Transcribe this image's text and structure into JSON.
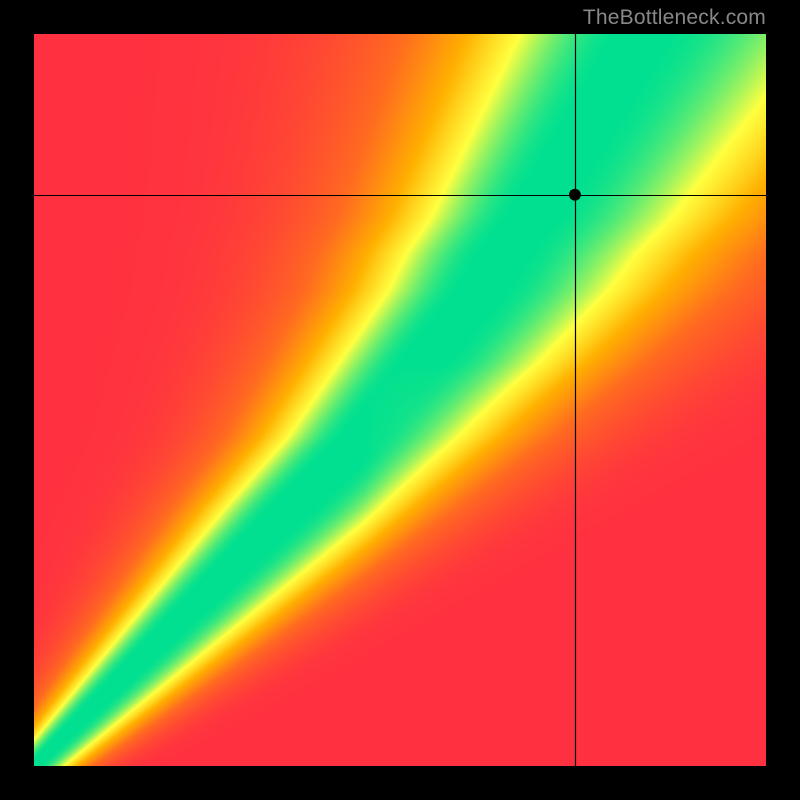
{
  "watermark": "TheBottleneck.com",
  "chart_data": {
    "type": "heatmap",
    "title": "",
    "xlabel": "",
    "ylabel": "",
    "xlim": [
      0,
      1
    ],
    "ylim": [
      0,
      1
    ],
    "marker": {
      "x": 0.74,
      "y": 0.78
    },
    "crosshair": {
      "x": 0.74,
      "y": 0.78
    },
    "color_scale": [
      "#ff3040",
      "#ff6a20",
      "#ffb000",
      "#ffff40",
      "#00e090"
    ],
    "description": "Smooth 2D heatmap with a narrow green optimal band curving from lower-left to upper-right; red in far corners, orange/yellow gradient elsewhere.",
    "optimal_band": [
      {
        "y": 0.0,
        "x": 0.0,
        "width": 0.02
      },
      {
        "y": 0.05,
        "x": 0.05,
        "width": 0.03
      },
      {
        "y": 0.1,
        "x": 0.1,
        "width": 0.04
      },
      {
        "y": 0.15,
        "x": 0.15,
        "width": 0.05
      },
      {
        "y": 0.2,
        "x": 0.2,
        "width": 0.06
      },
      {
        "y": 0.25,
        "x": 0.25,
        "width": 0.07
      },
      {
        "y": 0.3,
        "x": 0.3,
        "width": 0.08
      },
      {
        "y": 0.35,
        "x": 0.35,
        "width": 0.09
      },
      {
        "y": 0.4,
        "x": 0.4,
        "width": 0.09
      },
      {
        "y": 0.45,
        "x": 0.45,
        "width": 0.09
      },
      {
        "y": 0.5,
        "x": 0.49,
        "width": 0.09
      },
      {
        "y": 0.55,
        "x": 0.53,
        "width": 0.09
      },
      {
        "y": 0.6,
        "x": 0.57,
        "width": 0.09
      },
      {
        "y": 0.65,
        "x": 0.61,
        "width": 0.09
      },
      {
        "y": 0.7,
        "x": 0.64,
        "width": 0.09
      },
      {
        "y": 0.75,
        "x": 0.68,
        "width": 0.09
      },
      {
        "y": 0.8,
        "x": 0.71,
        "width": 0.09
      },
      {
        "y": 0.85,
        "x": 0.74,
        "width": 0.09
      },
      {
        "y": 0.9,
        "x": 0.77,
        "width": 0.09
      },
      {
        "y": 0.95,
        "x": 0.8,
        "width": 0.09
      },
      {
        "y": 1.0,
        "x": 0.83,
        "width": 0.09
      }
    ]
  }
}
